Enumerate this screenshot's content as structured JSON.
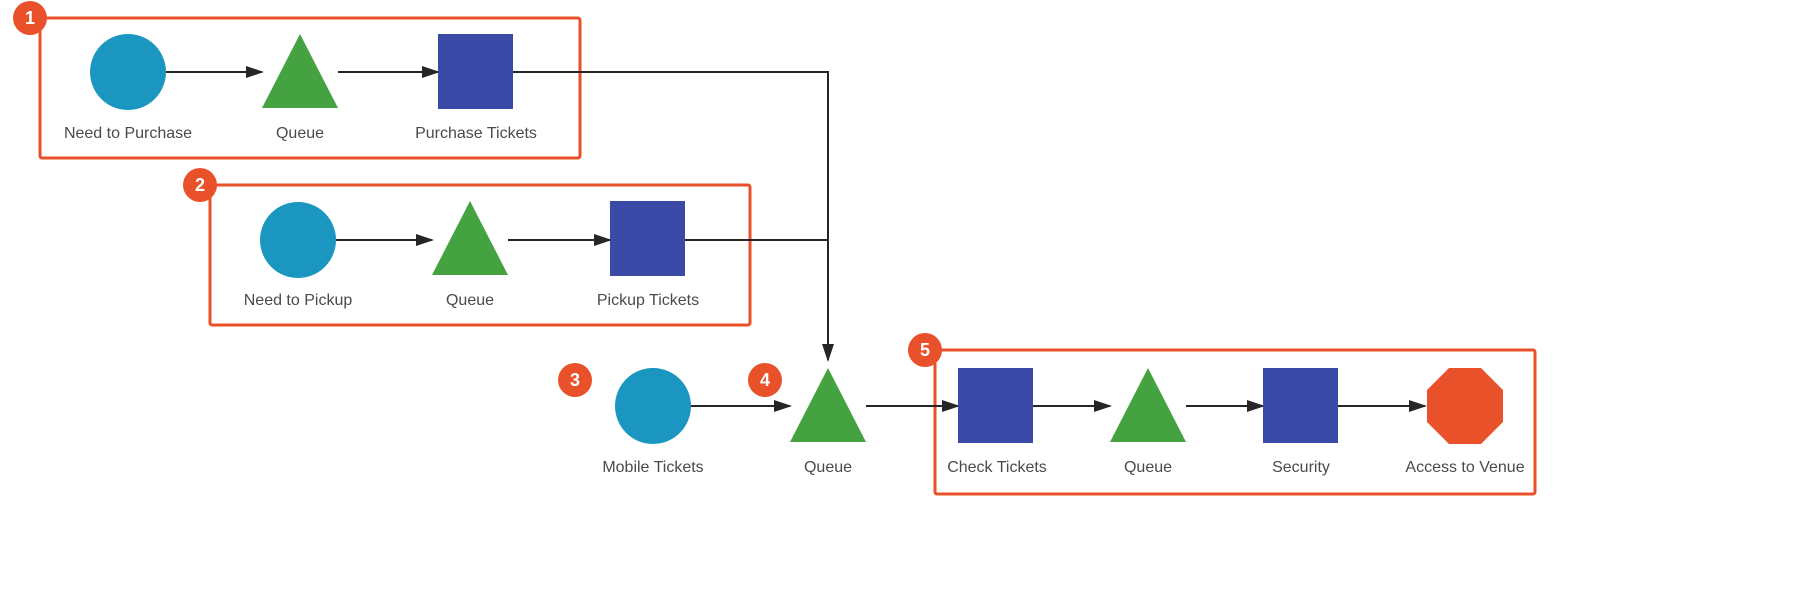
{
  "badge1": "1",
  "badge2": "2",
  "badge3": "3",
  "badge4": "4",
  "badge5": "5",
  "row1": {
    "start": "Need to Purchase",
    "queue": "Queue",
    "activity": "Purchase Tickets"
  },
  "row2": {
    "start": "Need to Pickup",
    "queue": "Queue",
    "activity": "Pickup Tickets"
  },
  "row3": {
    "mobile": "Mobile Tickets",
    "queue": "Queue"
  },
  "row5": {
    "check": "Check Tickets",
    "queue": "Queue",
    "security": "Security",
    "access": "Access to Venue"
  }
}
